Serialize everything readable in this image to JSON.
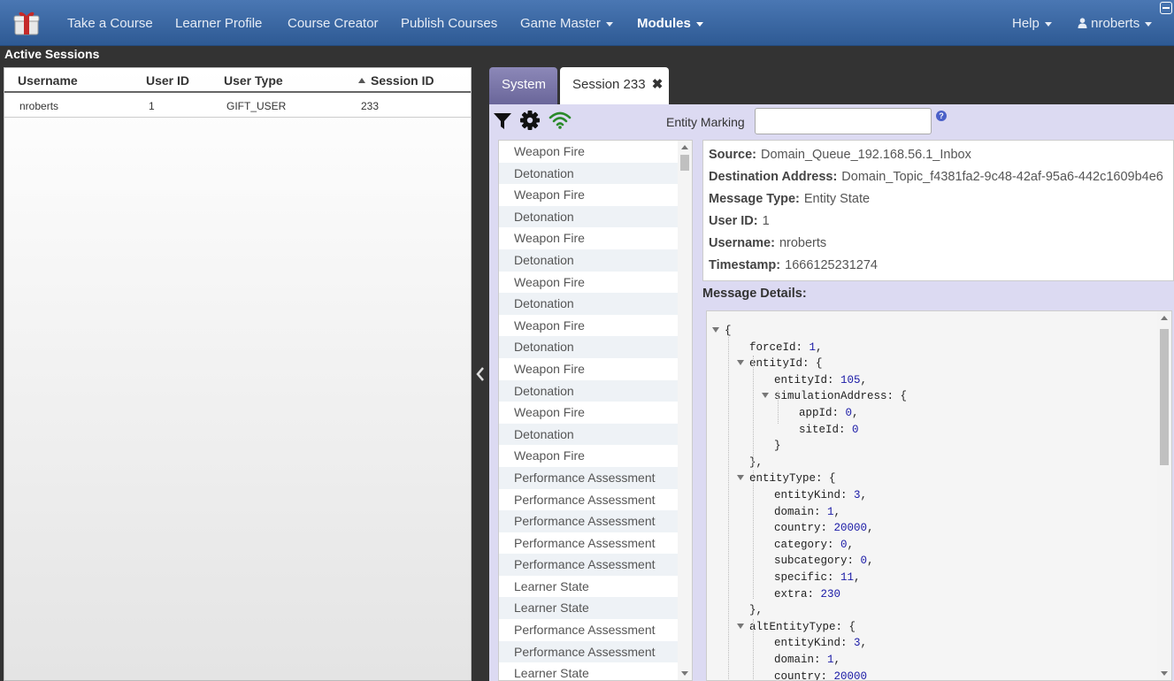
{
  "navbar": {
    "items": [
      {
        "label": "Take a Course",
        "dropdown": false
      },
      {
        "label": "Learner Profile",
        "dropdown": false
      },
      {
        "label": "Course Creator",
        "dropdown": false
      },
      {
        "label": "Publish Courses",
        "dropdown": false
      },
      {
        "label": "Game Master",
        "dropdown": true
      },
      {
        "label": "Modules",
        "dropdown": true,
        "active": true
      }
    ],
    "help_label": "Help",
    "user_label": "nroberts"
  },
  "sessions": {
    "title": "Active Sessions",
    "columns": [
      "Username",
      "User ID",
      "User Type",
      "Session ID"
    ],
    "sorted_column": "Session ID",
    "rows": [
      {
        "username": "nroberts",
        "user_id": "1",
        "user_type": "GIFT_USER",
        "session_id": "233"
      }
    ]
  },
  "tabs": {
    "system_label": "System",
    "session_label": "Session 233",
    "close_glyph": "✖"
  },
  "toolbar": {
    "entity_marking_label": "Entity Marking",
    "entity_marking_value": "",
    "help_glyph": "?"
  },
  "messages": [
    "Weapon Fire",
    "Detonation",
    "Weapon Fire",
    "Detonation",
    "Weapon Fire",
    "Detonation",
    "Weapon Fire",
    "Detonation",
    "Weapon Fire",
    "Detonation",
    "Weapon Fire",
    "Detonation",
    "Weapon Fire",
    "Detonation",
    "Weapon Fire",
    "Performance Assessment",
    "Performance Assessment",
    "Performance Assessment",
    "Performance Assessment",
    "Performance Assessment",
    "Learner State",
    "Learner State",
    "Performance Assessment",
    "Performance Assessment",
    "Learner State"
  ],
  "info": {
    "source_label": "Source:",
    "source": "Domain_Queue_192.168.56.1_Inbox",
    "destination_label": "Destination Address:",
    "destination": "Domain_Topic_f4381fa2-9c48-42af-95a6-442c1609b4e6",
    "message_type_label": "Message Type:",
    "message_type": "Entity State",
    "user_id_label": "User ID:",
    "user_id": "1",
    "username_label": "Username:",
    "username": "nroberts",
    "timestamp_label": "Timestamp:",
    "timestamp": "1666125231274"
  },
  "details_title": "Message Details:",
  "json_lines": [
    {
      "indent": 0,
      "tri": true,
      "key": "{",
      "val": "",
      "end": ""
    },
    {
      "indent": 1,
      "tri": false,
      "key": "forceId: ",
      "val": "1",
      "end": ","
    },
    {
      "indent": 1,
      "tri": true,
      "key": "entityId: {",
      "val": "",
      "end": ""
    },
    {
      "indent": 2,
      "tri": false,
      "key": "entityId: ",
      "val": "105",
      "end": ","
    },
    {
      "indent": 2,
      "tri": true,
      "key": "simulationAddress: {",
      "val": "",
      "end": ""
    },
    {
      "indent": 3,
      "tri": false,
      "key": "appId: ",
      "val": "0",
      "end": ","
    },
    {
      "indent": 3,
      "tri": false,
      "key": "siteId: ",
      "val": "0",
      "end": ""
    },
    {
      "indent": 2,
      "tri": false,
      "key": "}",
      "val": "",
      "end": ""
    },
    {
      "indent": 1,
      "tri": false,
      "key": "},",
      "val": "",
      "end": ""
    },
    {
      "indent": 1,
      "tri": true,
      "key": "entityType: {",
      "val": "",
      "end": ""
    },
    {
      "indent": 2,
      "tri": false,
      "key": "entityKind: ",
      "val": "3",
      "end": ","
    },
    {
      "indent": 2,
      "tri": false,
      "key": "domain: ",
      "val": "1",
      "end": ","
    },
    {
      "indent": 2,
      "tri": false,
      "key": "country: ",
      "val": "20000",
      "end": ","
    },
    {
      "indent": 2,
      "tri": false,
      "key": "category: ",
      "val": "0",
      "end": ","
    },
    {
      "indent": 2,
      "tri": false,
      "key": "subcategory: ",
      "val": "0",
      "end": ","
    },
    {
      "indent": 2,
      "tri": false,
      "key": "specific: ",
      "val": "11",
      "end": ","
    },
    {
      "indent": 2,
      "tri": false,
      "key": "extra: ",
      "val": "230",
      "end": ""
    },
    {
      "indent": 1,
      "tri": false,
      "key": "},",
      "val": "",
      "end": ""
    },
    {
      "indent": 1,
      "tri": true,
      "key": "altEntityType: {",
      "val": "",
      "end": ""
    },
    {
      "indent": 2,
      "tri": false,
      "key": "entityKind: ",
      "val": "3",
      "end": ","
    },
    {
      "indent": 2,
      "tri": false,
      "key": "domain: ",
      "val": "1",
      "end": ","
    },
    {
      "indent": 2,
      "tri": false,
      "key": "country: ",
      "val": "20000",
      "end": ""
    }
  ],
  "colors": {
    "navbar": "#3a67a3",
    "system_tab": "#7a76aa",
    "session_bg": "#dcdaf2",
    "signal_icon": "#2a8a2a"
  },
  "icons": [
    "gift-logo-icon",
    "user-icon",
    "filter-icon",
    "gear-icon",
    "signal-icon",
    "chevron-left-icon",
    "help-icon"
  ]
}
